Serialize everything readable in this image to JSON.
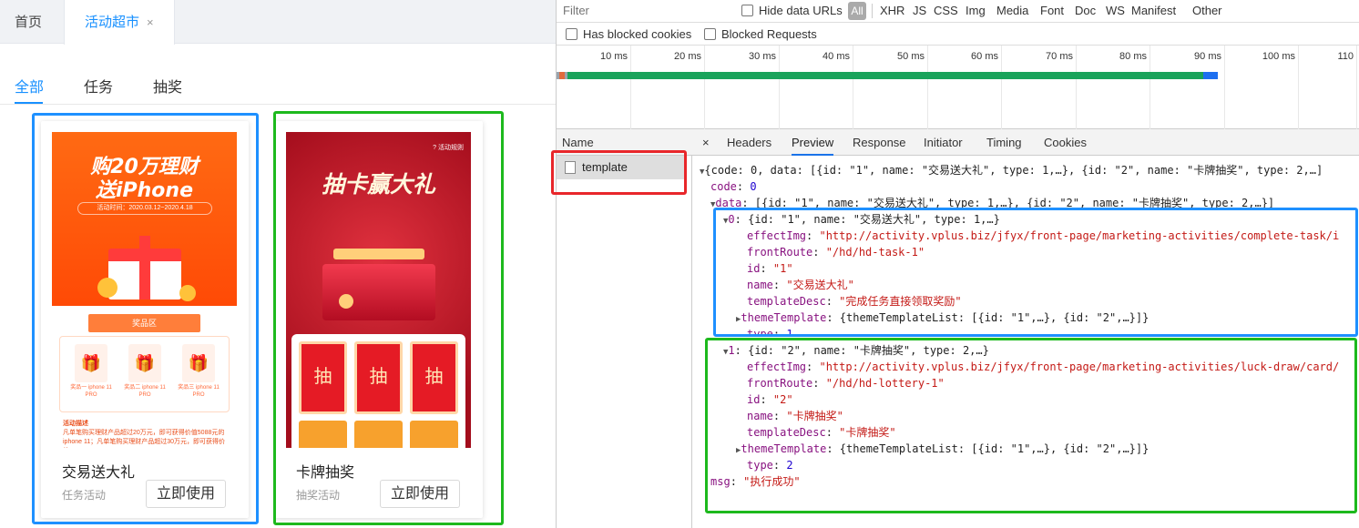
{
  "left": {
    "top_tabs": [
      {
        "label": "首页"
      },
      {
        "label": "活动超市",
        "close": "×"
      }
    ],
    "sub_tabs": [
      "全部",
      "任务",
      "抽奖"
    ],
    "cards": [
      {
        "title": "交易送大礼",
        "subtitle": "任务活动",
        "button": "立即使用",
        "poster": {
          "line1": "购20万理财",
          "line2": "送iPhone",
          "date": "活动时间：2020.03.12~2020.4.18",
          "band": "奖品区",
          "prizes": [
            "奖品一 iphone 11 PRO",
            "奖品二 iphone 11 PRO",
            "奖品三 iphone 11 PRO"
          ],
          "desc_title": "活动描述",
          "desc": "凡单笔购买理财产品超过20万元，即可获得价值5088元的iphone 11；凡单笔购买理财产品超过30万元，即可获得价值"
        }
      },
      {
        "title": "卡牌抽奖",
        "subtitle": "抽奖活动",
        "button": "立即使用",
        "poster": {
          "title": "抽卡赢大礼",
          "rule": "? 活动规则",
          "cards": [
            "抽",
            "抽",
            "抽"
          ]
        }
      }
    ]
  },
  "devtools": {
    "filter_placeholder": "Filter",
    "hide_data_urls": "Hide data URLs",
    "type_filters": [
      "All",
      "XHR",
      "JS",
      "CSS",
      "Img",
      "Media",
      "Font",
      "Doc",
      "WS",
      "Manifest",
      "Other"
    ],
    "has_blocked_cookies": "Has blocked cookies",
    "blocked_requests": "Blocked Requests",
    "timeline_ticks": [
      "10 ms",
      "20 ms",
      "30 ms",
      "40 ms",
      "50 ms",
      "60 ms",
      "70 ms",
      "80 ms",
      "90 ms",
      "100 ms",
      "110"
    ],
    "name_header": "Name",
    "request_name": "template",
    "detail_tabs": [
      "×",
      "Headers",
      "Preview",
      "Response",
      "Initiator",
      "Timing",
      "Cookies"
    ],
    "active_detail_tab": "Preview",
    "json_lines": {
      "root": "{code: 0, data: [{id: \"1\", name: \"交易送大礼\", type: 1,…}, {id: \"2\", name: \"卡牌抽奖\", type: 2,…]",
      "code_key": "code",
      "code_val": "0",
      "data_summary": "[{id: \"1\", name: \"交易送大礼\", type: 1,…}, {id: \"2\", name: \"卡牌抽奖\", type: 2,…}]",
      "item0_summary": "{id: \"1\", name: \"交易送大礼\", type: 1,…}",
      "item0_effectImg": "\"http://activity.vplus.biz/jfyx/front-page/marketing-activities/complete-task/i",
      "item0_frontRoute": "\"/hd/hd-task-1\"",
      "item0_id": "\"1\"",
      "item0_name": "\"交易送大礼\"",
      "item0_templateDesc": "\"完成任务直接领取奖励\"",
      "item0_theme": "{themeTemplateList: [{id: \"1\",…}, {id: \"2\",…}]}",
      "item0_type": "1",
      "item1_summary": "{id: \"2\", name: \"卡牌抽奖\", type: 2,…}",
      "item1_effectImg": "\"http://activity.vplus.biz/jfyx/front-page/marketing-activities/luck-draw/card/",
      "item1_frontRoute": "\"/hd/hd-lottery-1\"",
      "item1_id": "\"2\"",
      "item1_name": "\"卡牌抽奖\"",
      "item1_templateDesc": "\"卡牌抽奖\"",
      "item1_theme": "{themeTemplateList: [{id: \"1\",…}, {id: \"2\",…}]}",
      "item1_type": "2",
      "msg_val": "\"执行成功\""
    }
  }
}
